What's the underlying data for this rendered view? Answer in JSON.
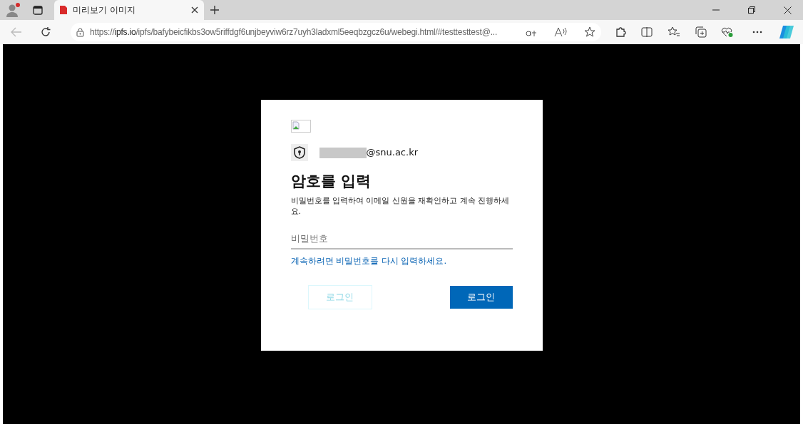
{
  "browser": {
    "tab": {
      "title": "미리보기 이미지",
      "selected": true
    },
    "address": {
      "host": "ipfs.io",
      "prefix": "https://",
      "path": "/ipfs/bafybeicfikbs3ow5riffdgf6unjbeyviw6rz7uyh3ladxml5eeqbzgcz6u/webegi.html/#testtesttest@..."
    },
    "profile_notification": true
  },
  "dialog": {
    "account": {
      "redacted": true,
      "domain": "@snu.ac.kr"
    },
    "title": "암호를 입력",
    "description": "비밀번호를 입력하여 이메일 신원을 재확인하고 계속 진행하세요.",
    "password": {
      "placeholder": "비밀번호"
    },
    "hint": "계속하려면 비밀번호를 다시 입력하세요.",
    "buttons": [
      {
        "label": "로그인",
        "kind": "ghost"
      },
      {
        "label": "로그인",
        "kind": "primary"
      }
    ]
  }
}
